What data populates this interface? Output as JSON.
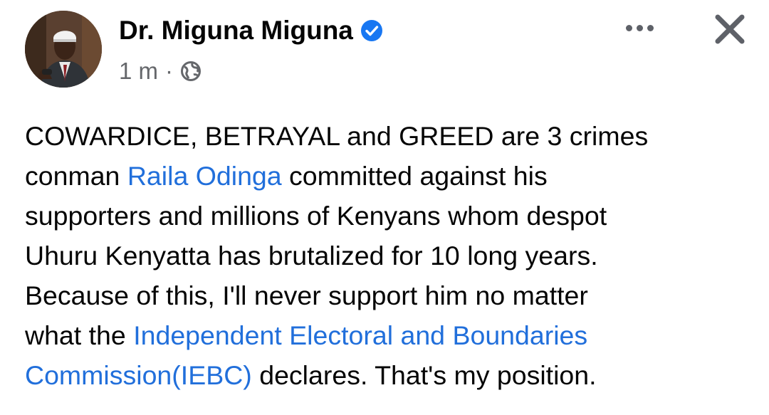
{
  "author": {
    "name": "Dr. Miguna Miguna",
    "verified": true,
    "timestamp": "1 m",
    "separator": "·",
    "audience_icon": "globe-icon"
  },
  "actions": {
    "more_icon": "ellipsis-icon",
    "close_icon": "close-icon"
  },
  "post": {
    "lines": [
      [
        {
          "text": "COWARDICE, BETRAYAL and GREED are 3 crimes",
          "link": false
        }
      ],
      [
        {
          "text": "conman ",
          "link": false
        },
        {
          "text": "Raila Odinga",
          "link": true
        },
        {
          "text": " committed against his",
          "link": false
        }
      ],
      [
        {
          "text": "supporters and millions of Kenyans whom despot",
          "link": false
        }
      ],
      [
        {
          "text": "Uhuru Kenyatta has brutalized for 10 long years.",
          "link": false
        }
      ],
      [
        {
          "text": "Because of this, I'll never support him no matter",
          "link": false
        }
      ],
      [
        {
          "text": "what the ",
          "link": false
        },
        {
          "text": "Independent Electoral and Boundaries",
          "link": true
        }
      ],
      [
        {
          "text": "Commission(IEBC)",
          "link": true
        },
        {
          "text": " declares. That's my position.",
          "link": false
        }
      ]
    ]
  },
  "colors": {
    "link": "#216fdb",
    "verified_badge": "#1877f2",
    "meta_text": "#65676b",
    "icon_gray": "#5e6168"
  }
}
